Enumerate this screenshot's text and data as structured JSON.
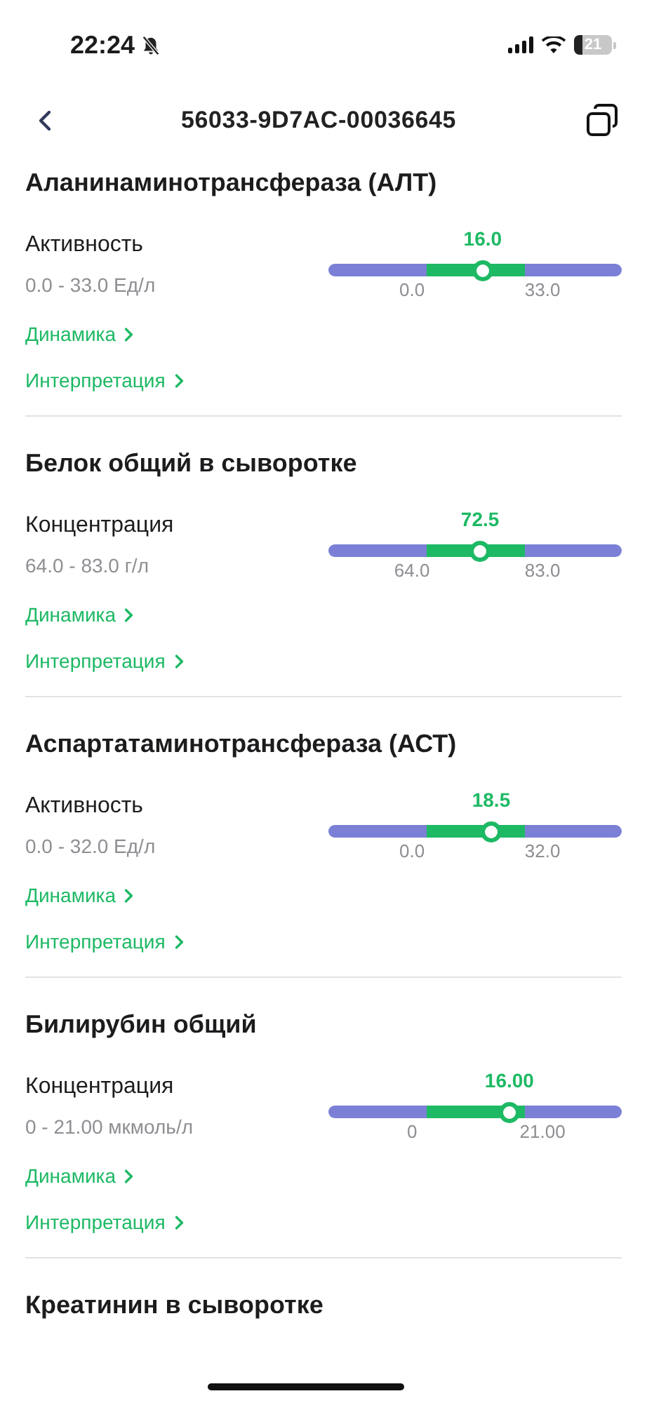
{
  "status_bar": {
    "time": "22:24",
    "battery": "21"
  },
  "header": {
    "title": "56033-9D7AC-00036645"
  },
  "sections": [
    {
      "title": "Аланинаминотрансфераза (АЛТ)",
      "name": "Активность",
      "range": "0.0 - 33.0 Ед/л",
      "value": "16.0",
      "level": 0.526,
      "low": "0.0",
      "high": "33.0",
      "links": [
        "Динамика",
        "Интерпретация"
      ]
    },
    {
      "title": "Белок общий в сыворотке",
      "name": "Концентрация",
      "range": "64.0 - 83.0 г/л",
      "value": "72.5",
      "level": 0.517,
      "low": "64.0",
      "high": "83.0",
      "links": [
        "Динамика",
        "Интерпретация"
      ]
    },
    {
      "title": "Аспартатаминотрансфераза (АСТ)",
      "name": "Активность",
      "range": "0.0 - 32.0 Ед/л",
      "value": "18.5",
      "level": 0.555,
      "low": "0.0",
      "high": "32.0",
      "links": [
        "Динамика",
        "Интерпретация"
      ]
    },
    {
      "title": "Билирубин общий",
      "name": "Концентрация",
      "range": "0 - 21.00 мкмоль/л",
      "value": "16.00",
      "level": 0.617,
      "low": "0",
      "high": "21.00",
      "links": [
        "Динамика",
        "Интерпретация"
      ]
    },
    {
      "title": "Креатинин в сыворотке"
    }
  ]
}
